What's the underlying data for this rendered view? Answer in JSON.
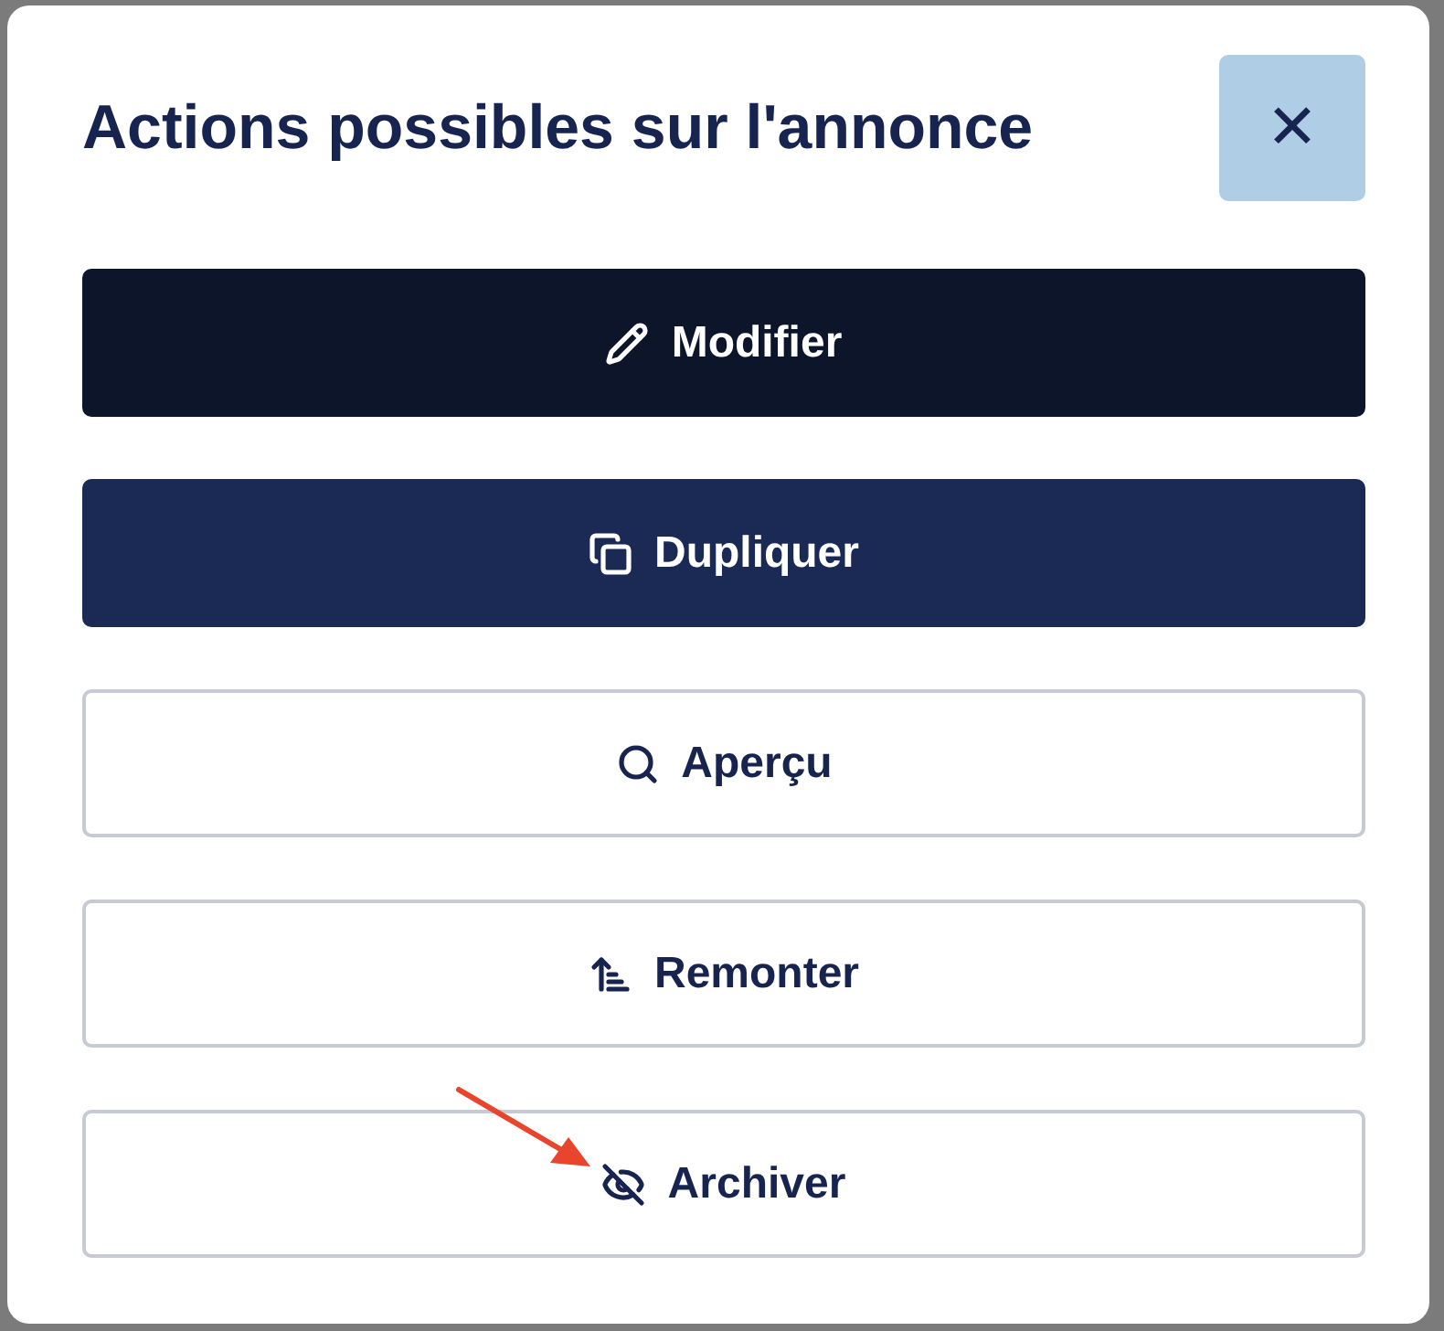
{
  "dialog": {
    "title": "Actions possibles sur l'annonce",
    "close_label": "✕",
    "actions": [
      {
        "label": "Modifier",
        "kind": "primary"
      },
      {
        "label": "Dupliquer",
        "kind": "secondary"
      },
      {
        "label": "Aperçu",
        "kind": "outline"
      },
      {
        "label": "Remonter",
        "kind": "outline"
      },
      {
        "label": "Archiver",
        "kind": "outline"
      }
    ]
  }
}
